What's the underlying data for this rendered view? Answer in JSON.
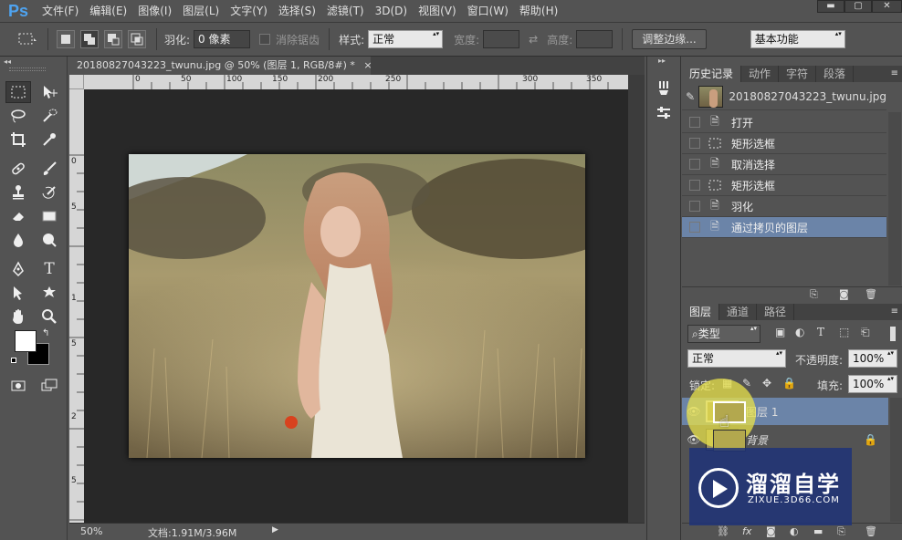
{
  "app": {
    "logo": "Ps"
  },
  "menu": [
    "文件(F)",
    "编辑(E)",
    "图像(I)",
    "图层(L)",
    "文字(Y)",
    "选择(S)",
    "滤镜(T)",
    "3D(D)",
    "视图(V)",
    "窗口(W)",
    "帮助(H)"
  ],
  "window_controls": {
    "min": "▬",
    "max": "▢",
    "close": "✕"
  },
  "options": {
    "feather_label": "羽化:",
    "feather_value": "0 像素",
    "antialias_label": "消除锯齿",
    "style_label": "样式:",
    "style_value": "正常",
    "width_label": "宽度:",
    "height_label": "高度:",
    "refine_edge": "调整边缘...",
    "workspace": "基本功能"
  },
  "document": {
    "tab_title": "20180827043223_twunu.jpg @ 50% (图层 1, RGB/8#) *",
    "close": "×",
    "zoom": "50%",
    "doc_info": "文档:1.91M/3.96M"
  },
  "ruler_h_ticks": [
    "0",
    "50",
    "100",
    "150",
    "200",
    "250",
    "300",
    "350"
  ],
  "ruler_v_ticks": [
    "0",
    "5",
    "1",
    "5",
    "2",
    "5"
  ],
  "history_panel": {
    "tabs": [
      "历史记录",
      "动作",
      "字符",
      "段落"
    ],
    "snapshot_name": "20180827043223_twunu.jpg",
    "items": [
      {
        "label": "打开",
        "icon": "doc-icon"
      },
      {
        "label": "矩形选框",
        "icon": "marquee-icon"
      },
      {
        "label": "取消选择",
        "icon": "doc-icon"
      },
      {
        "label": "矩形选框",
        "icon": "marquee-icon"
      },
      {
        "label": "羽化",
        "icon": "doc-icon"
      },
      {
        "label": "通过拷贝的图层",
        "icon": "doc-icon"
      }
    ]
  },
  "layers_panel": {
    "tabs": [
      "图层",
      "通道",
      "路径"
    ],
    "filter_kind": "类型",
    "blend_mode": "正常",
    "opacity_label": "不透明度:",
    "opacity_value": "100%",
    "lock_label": "锁定:",
    "fill_label": "填充:",
    "fill_value": "100%",
    "layers": [
      {
        "name": "图层 1",
        "selected": true
      },
      {
        "name": "背景",
        "selected": false,
        "locked": true
      }
    ],
    "bottom_icons": [
      "link-icon",
      "fx-icon",
      "mask-icon",
      "adjustment-icon",
      "group-icon",
      "new-layer-icon",
      "trash-icon"
    ]
  },
  "watermark": {
    "title": "溜溜自学",
    "url": "ZIXUE.3D66.COM"
  },
  "colors": {
    "ui_bg": "#535353",
    "selected_row": "#6b84a8",
    "cursor_highlight": "#e8e24a",
    "ps_blue": "#4ea3f0"
  }
}
